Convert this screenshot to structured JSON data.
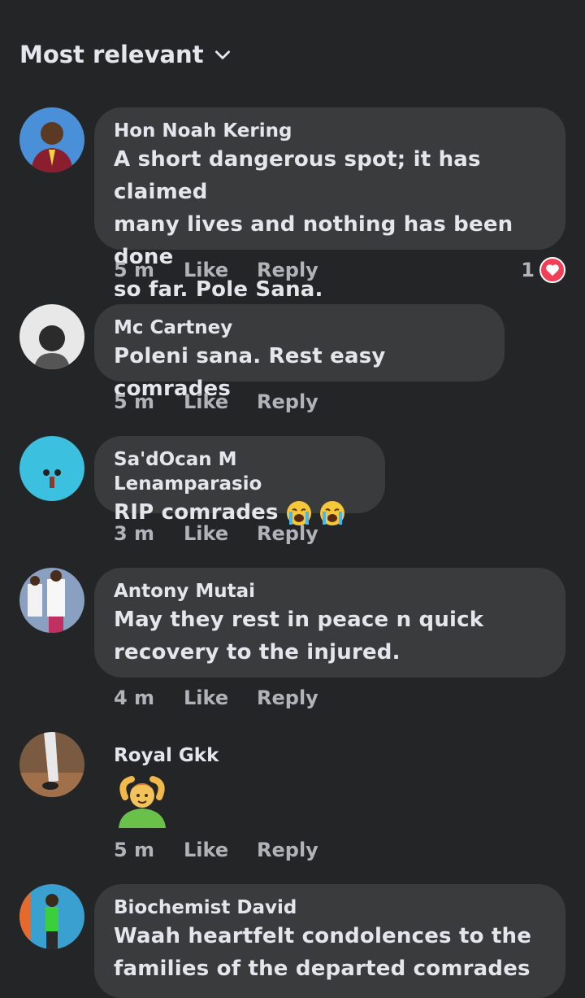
{
  "sort": {
    "label": "Most relevant"
  },
  "comments": [
    {
      "author": "Hon Noah Kering",
      "lines": [
        "A short dangerous spot; it has claimed",
        "many lives and nothing has been done",
        "so far. Pole Sana."
      ],
      "time": "5 m",
      "like": "Like",
      "reply": "Reply",
      "reaction_count": "1"
    },
    {
      "author": "Mc Cartney",
      "lines": [
        "Poleni sana. Rest easy comrades"
      ],
      "time": "5 m",
      "like": "Like",
      "reply": "Reply"
    },
    {
      "author": "Sa'dOcan M Lenamparasio",
      "lines": [
        "RIP comrades"
      ],
      "emoji": "crying-face-icon",
      "time": "3 m",
      "like": "Like",
      "reply": "Reply"
    },
    {
      "author": "Antony Mutai",
      "lines": [
        "May they rest in peace n quick",
        "recovery to the injured."
      ],
      "time": "4 m",
      "like": "Like",
      "reply": "Reply"
    },
    {
      "author": "Royal Gkk",
      "emoji": "person-gesturing-ok-icon",
      "time": "5 m",
      "like": "Like",
      "reply": "Reply"
    },
    {
      "author": "Biochemist David",
      "lines": [
        "Waah heartfelt condolences to the",
        "families of the departed comrades"
      ]
    }
  ],
  "colors": {
    "background": "#242526",
    "bubble": "#3a3b3c",
    "meta_text": "#b0b3b8",
    "heart": "#f33e58"
  }
}
